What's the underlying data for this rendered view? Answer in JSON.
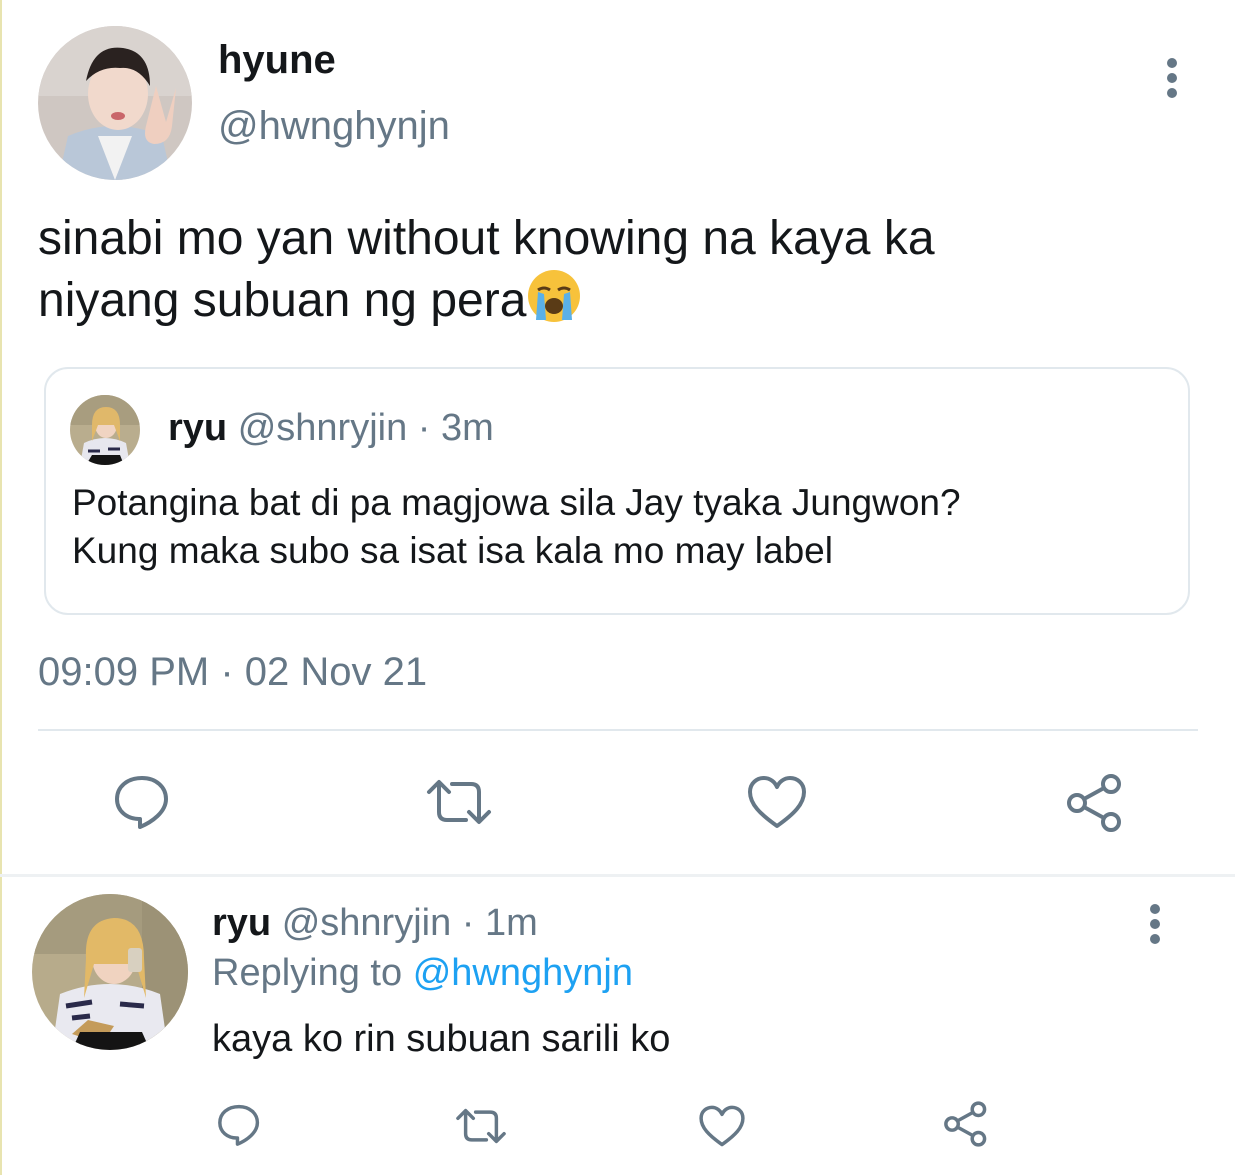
{
  "main_tweet": {
    "display_name": "hyune",
    "handle": "@hwnghynjn",
    "text_line1": "sinabi mo yan without knowing na kaya ka",
    "text_line2": "niyang subuan ng pera",
    "emoji": "loudly-crying-face",
    "quoted_tweet": {
      "display_name": "ryu",
      "handle": "@shnryjin",
      "separator": "·",
      "time": "3m",
      "text_line1": "Potangina bat di pa magjowa sila Jay tyaka Jungwon?",
      "text_line2": "Kung maka subo sa isat isa kala mo may label"
    },
    "timestamp": "09:09 PM · 02 Nov 21",
    "actions": [
      "reply-icon",
      "retweet-icon",
      "like-icon",
      "share-icon"
    ]
  },
  "reply_tweet": {
    "display_name": "ryu",
    "handle": "@shnryjin",
    "separator": "·",
    "time": "1m",
    "replying_label": "Replying to",
    "replying_mention": "@hwnghynjn",
    "text": "kaya ko rin subuan sarili ko",
    "actions": [
      "reply-icon",
      "retweet-icon",
      "like-icon",
      "share-icon"
    ]
  },
  "colors": {
    "text_primary": "#14171a",
    "text_secondary": "#657786",
    "link": "#1da1f2",
    "border": "#e1e8ed"
  }
}
